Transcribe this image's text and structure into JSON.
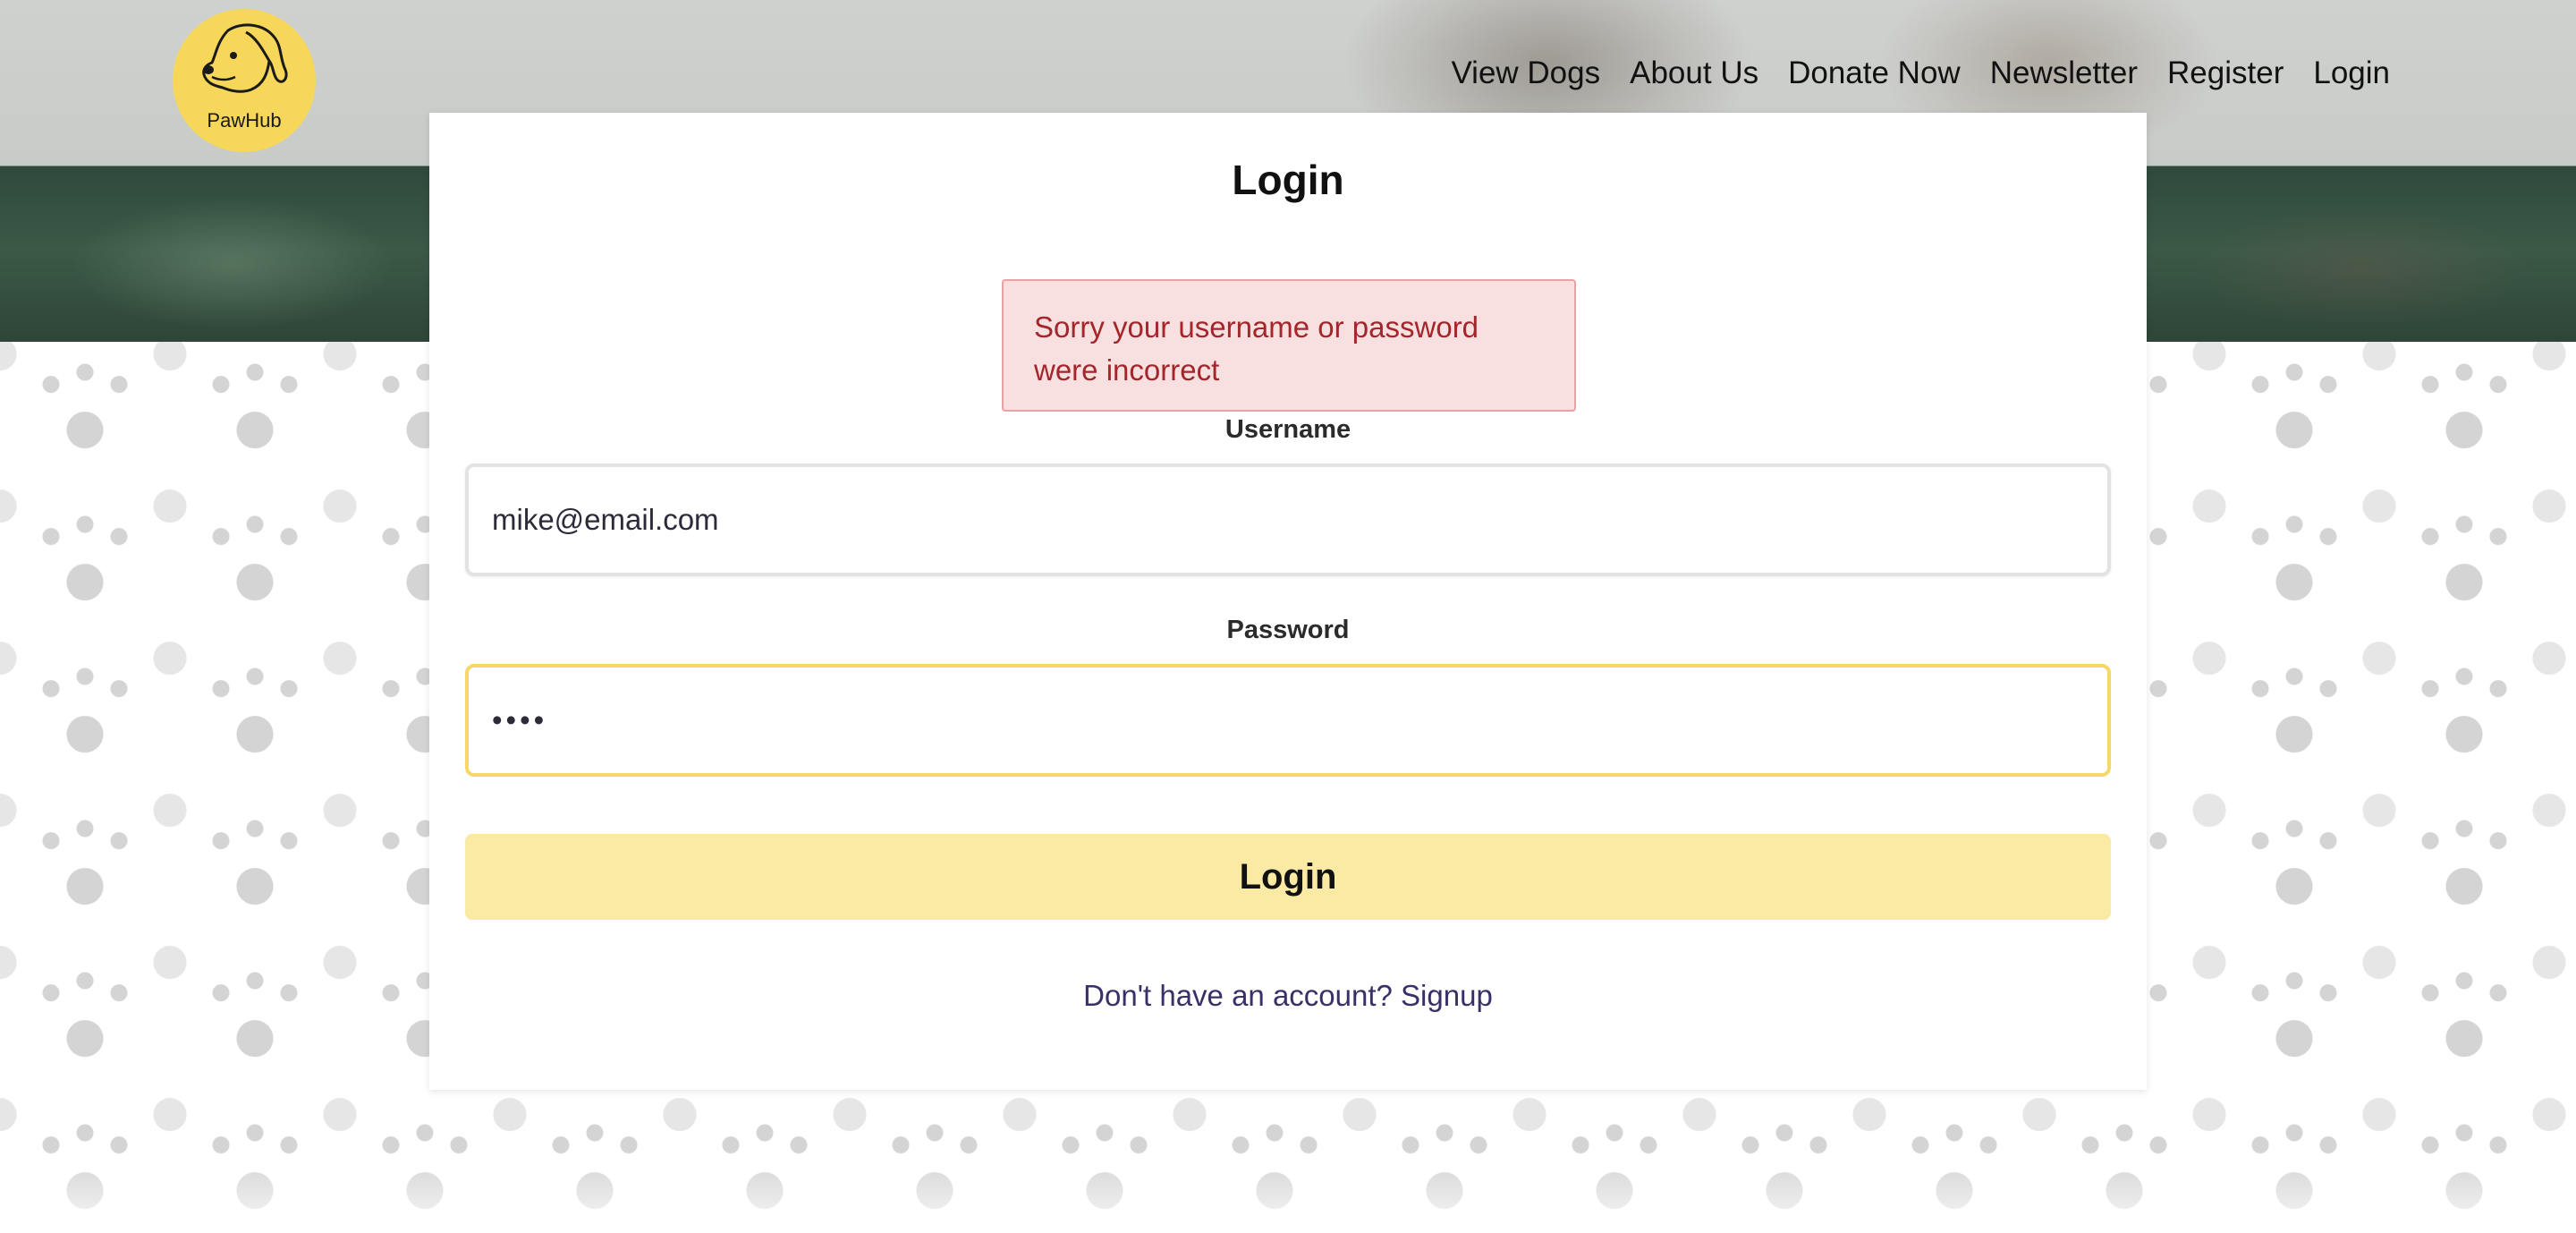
{
  "brand": {
    "logo_text": "PawHub",
    "accent_color": "#f7d75a"
  },
  "nav": {
    "items": [
      {
        "label": "View Dogs"
      },
      {
        "label": "About Us"
      },
      {
        "label": "Donate Now"
      },
      {
        "label": "Newsletter"
      },
      {
        "label": "Register"
      },
      {
        "label": "Login"
      }
    ]
  },
  "login_form": {
    "title": "Login",
    "error_message": "Sorry your username or password were incorrect",
    "error_color": "#a3262b",
    "username_label": "Username",
    "username_value": "mike@email.com",
    "password_label": "Password",
    "password_value": "••••",
    "submit_label": "Login",
    "submit_color": "#fbeaa3",
    "signup_text": "Don't have an account? Signup"
  }
}
